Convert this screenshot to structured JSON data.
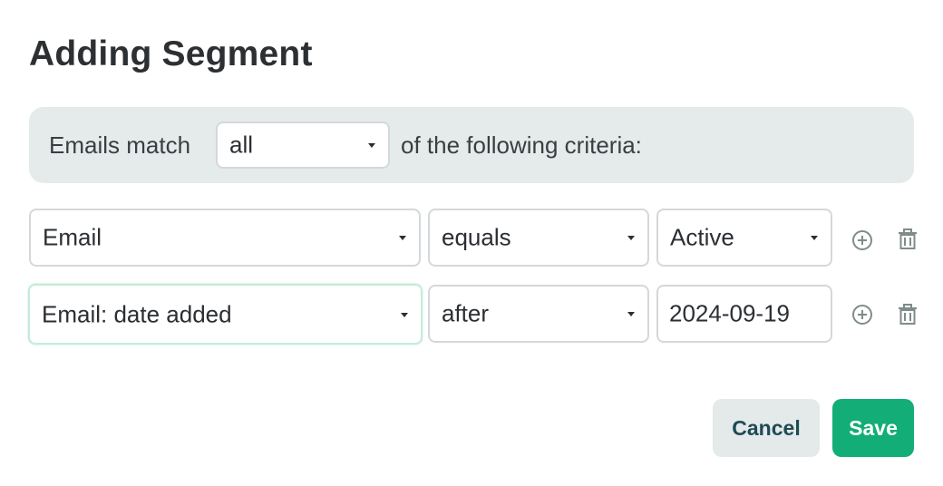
{
  "dialog": {
    "title": "Adding Segment"
  },
  "match": {
    "prefix": "Emails match",
    "mode": "all",
    "suffix": "of the following criteria:"
  },
  "criteria": [
    {
      "field": "Email",
      "operator": "equals",
      "value": "Active"
    },
    {
      "field": "Email: date added",
      "operator": "after",
      "value": "2024-09-19"
    }
  ],
  "actions": {
    "cancel_label": "Cancel",
    "save_label": "Save"
  },
  "colors": {
    "accent": "#13ad77",
    "panel": "#e5ebea",
    "cancel_bg": "#e3eae9",
    "cancel_text": "#1f4a55",
    "focus_border": "#c6ecd9",
    "icon": "#7f8c8a"
  },
  "icons": {
    "dropdown": "chevron-down-icon",
    "add": "plus-circle-icon",
    "delete": "trash-icon"
  }
}
